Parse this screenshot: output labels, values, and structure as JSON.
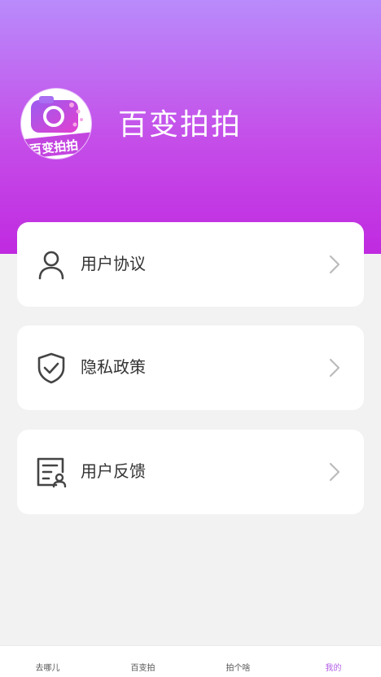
{
  "app": {
    "name": "百变拍拍",
    "logo_text": "百变拍拍"
  },
  "menu": [
    {
      "label": "用户协议",
      "icon": "user-icon"
    },
    {
      "label": "隐私政策",
      "icon": "shield-check-icon"
    },
    {
      "label": "用户反馈",
      "icon": "feedback-document-icon"
    }
  ],
  "tabs": [
    {
      "label": "去哪儿",
      "active": false
    },
    {
      "label": "百变拍",
      "active": false
    },
    {
      "label": "拍个啥",
      "active": false
    },
    {
      "label": "我的",
      "active": true
    }
  ],
  "colors": {
    "header_top": "#b98bfb",
    "header_bottom": "#c02ae0",
    "active_tab": "#b35de6",
    "background": "#f2f2f2"
  }
}
